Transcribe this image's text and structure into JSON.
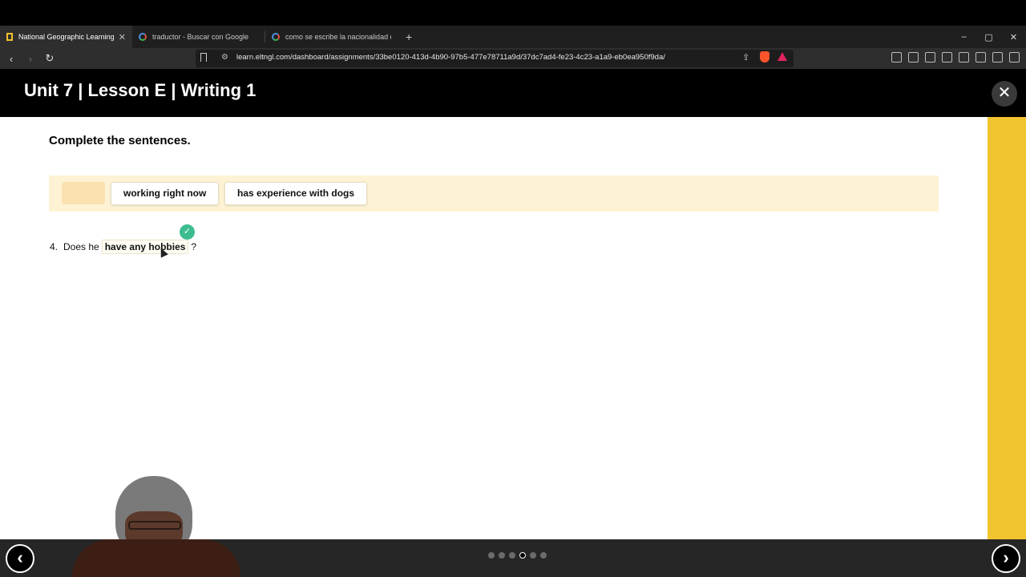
{
  "browser": {
    "tabs": [
      {
        "title": "National Geographic Learning",
        "favicon": "natgeo-icon",
        "active": true
      },
      {
        "title": "traductor - Buscar con Google",
        "favicon": "google-icon",
        "active": false
      },
      {
        "title": "como se escribe la nacionalidad de in",
        "favicon": "google-icon",
        "active": false
      }
    ],
    "new_tab_label": "+",
    "tab_close": "✕",
    "window_controls": {
      "minimize": "–",
      "restore": "▢",
      "close": "✕"
    },
    "nav": {
      "back": "‹",
      "forward": "›",
      "reload": "↻"
    },
    "url": "learn.eltngl.com/dashboard/assignments/33be0120-413d-4b90-97b5-477e78711a9d/37dc7ad4-fe23-4c23-a1a9-eb0ea950f9da/"
  },
  "app": {
    "title": "Unit 7 | Lesson E | Writing 1",
    "close_label": "✕"
  },
  "exercise": {
    "instruction": "Complete the sentences.",
    "word_bank": [
      {
        "label": "",
        "state": "used"
      },
      {
        "label": "working right now",
        "state": "available"
      },
      {
        "label": "has experience with dogs",
        "state": "available"
      }
    ],
    "question": {
      "number": "4.",
      "prefix": "Does he",
      "answer": "have any hobbies",
      "suffix": "?",
      "status": "correct",
      "check_glyph": "✓"
    }
  },
  "footer": {
    "prev_label": "‹",
    "next_label": "›",
    "pagination": {
      "total": 6,
      "current": 4
    }
  },
  "colors": {
    "accent_yellow": "#f2c42e",
    "word_bank_bg": "#fdf3d4",
    "correct_green": "#3dbd8e"
  }
}
